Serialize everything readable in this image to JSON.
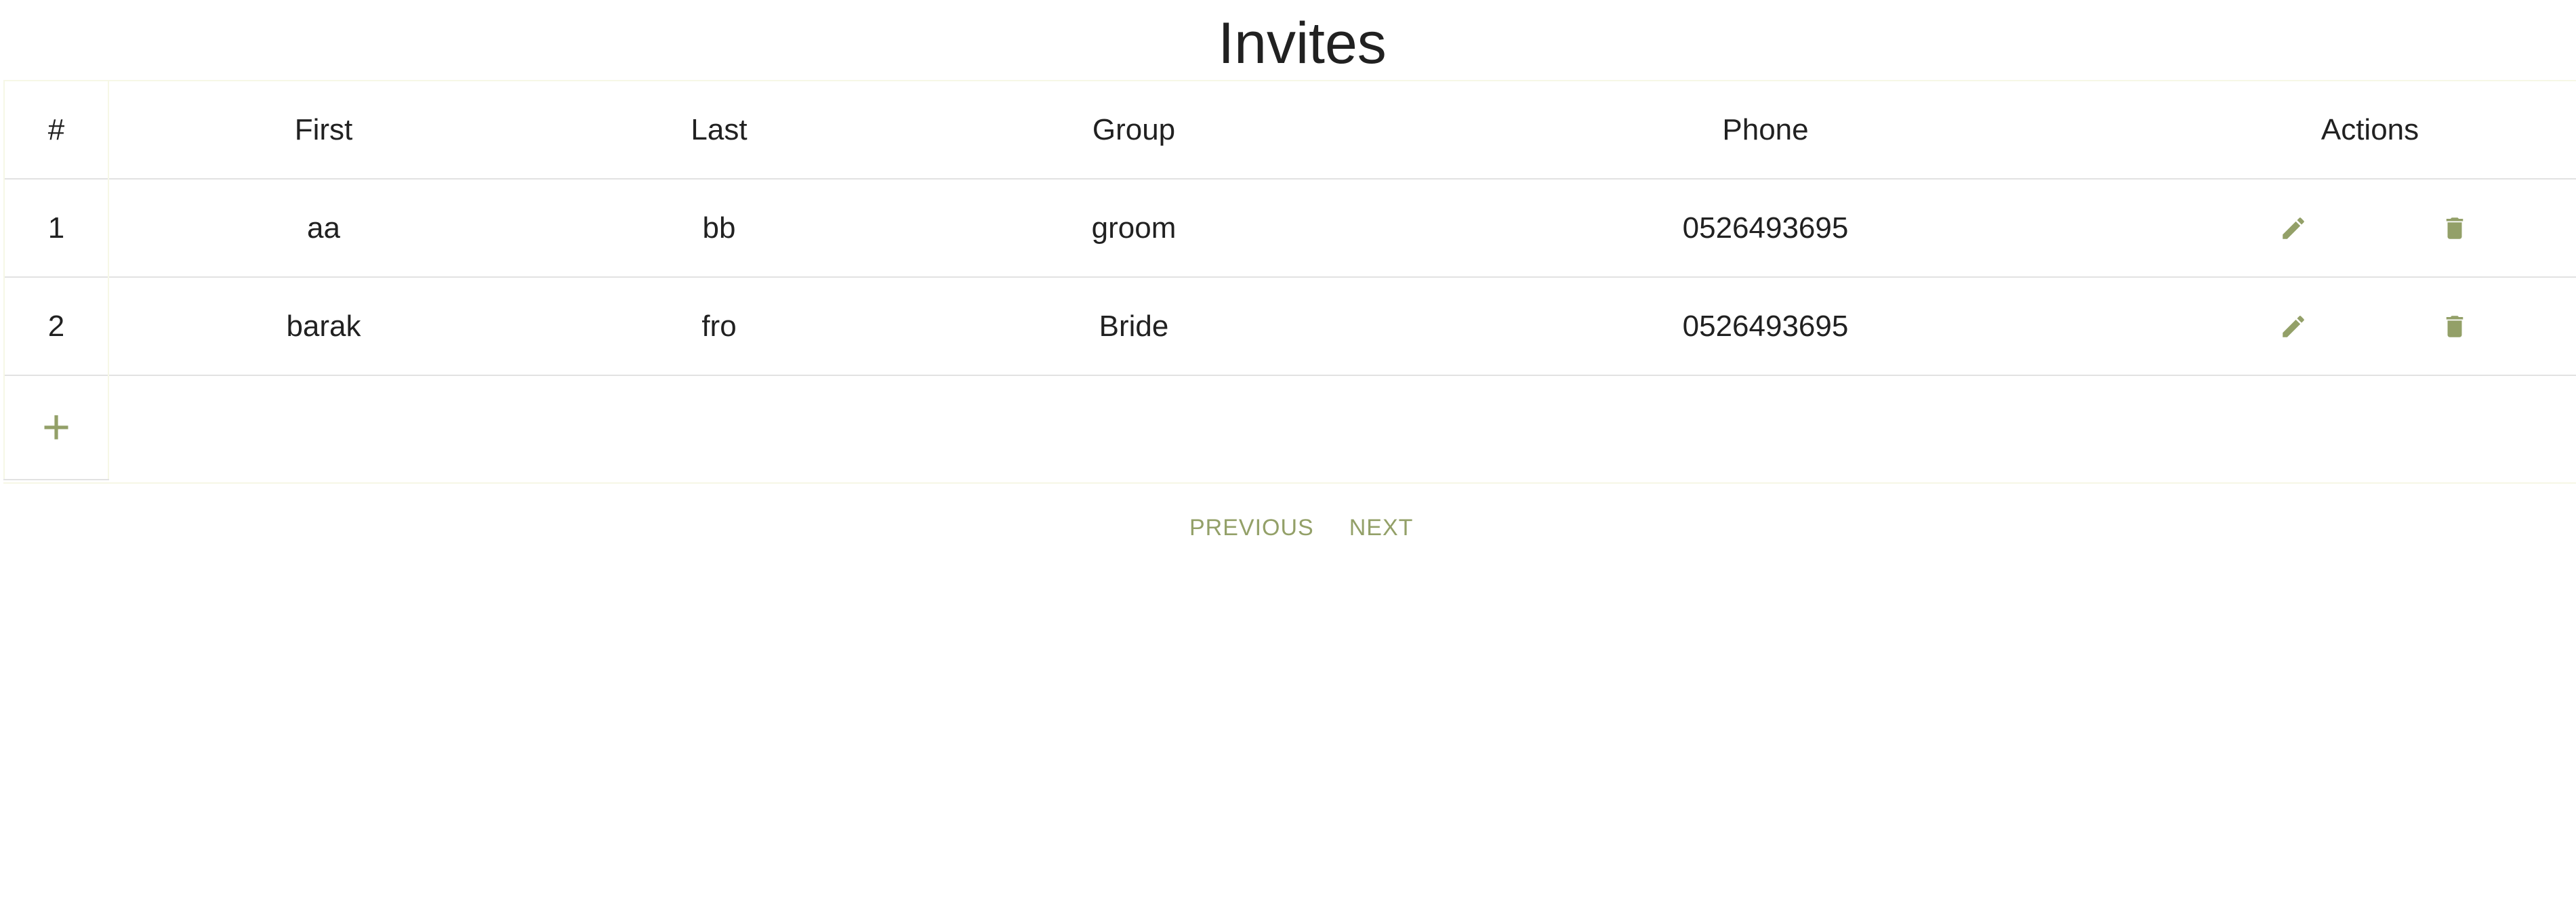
{
  "page": {
    "title": "Invites"
  },
  "table": {
    "columns": [
      "#",
      "First",
      "Last",
      "Group",
      "Phone",
      "Actions"
    ],
    "rows": [
      {
        "num": "1",
        "first": "aa",
        "last": "bb",
        "group": "groom",
        "phone": "0526493695"
      },
      {
        "num": "2",
        "first": "barak",
        "last": "fro",
        "group": "Bride",
        "phone": "0526493695"
      }
    ],
    "add_label": "+"
  },
  "pagination": {
    "previous_label": "PREVIOUS",
    "next_label": "NEXT"
  },
  "colors": {
    "accent": "#93a068",
    "text": "#212121",
    "row_border": "#e2e2e2",
    "frame_border": "#f6f7e6"
  },
  "icons": {
    "edit": "pencil-icon",
    "delete": "trash-icon",
    "add": "plus-icon"
  }
}
